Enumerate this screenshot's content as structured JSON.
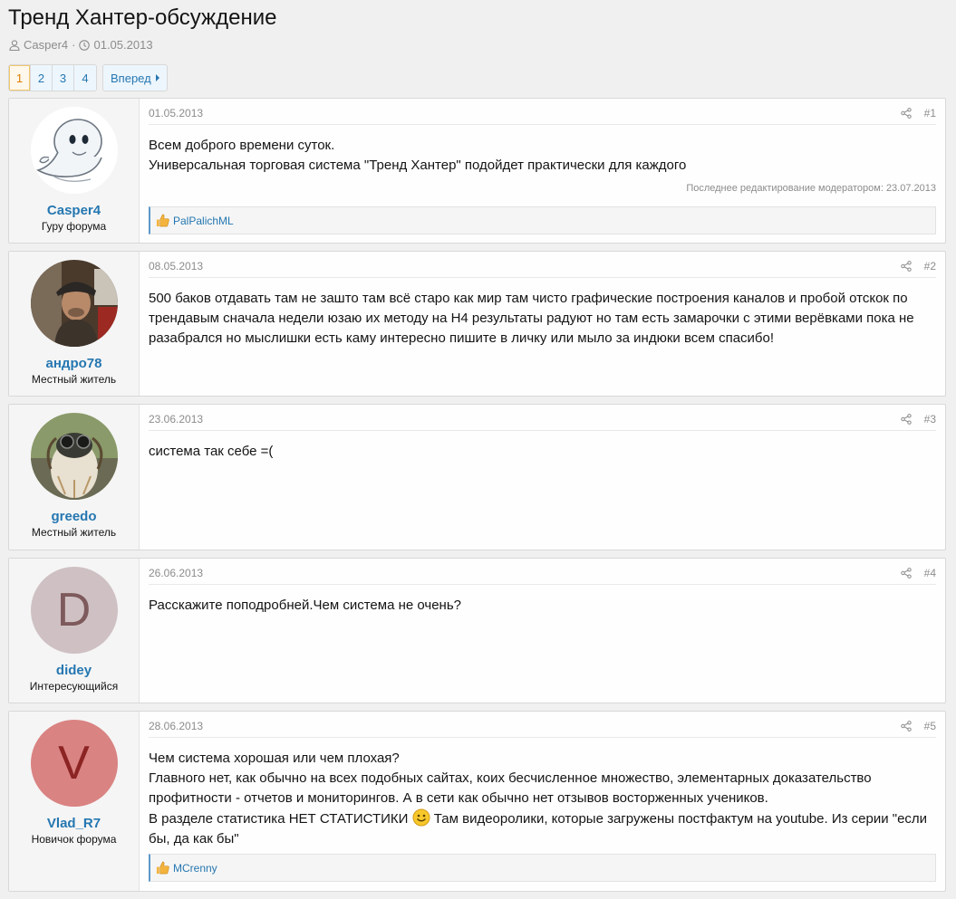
{
  "thread": {
    "title": "Тренд Хантер-обсуждение",
    "author": "Casper4",
    "separator": "·",
    "date": "01.05.2013"
  },
  "pagination": {
    "pages": [
      "1",
      "2",
      "3",
      "4"
    ],
    "current": "1",
    "next_label": "Вперед"
  },
  "colors": {
    "link": "#2577b1",
    "current_page": "#df7d00",
    "avatar_didey_bg": "#cfc1c3",
    "avatar_didey_fg": "#7e5a5c",
    "avatar_vlad_bg": "#d98382",
    "avatar_vlad_fg": "#8b2423"
  },
  "posts": [
    {
      "date": "01.05.2013",
      "number": "#1",
      "username": "Casper4",
      "user_title": "Гуру форума",
      "avatar": "casper-ghost-icon",
      "lines": [
        "Всем доброго времени суток.",
        "Универсальная торговая система \"Тренд Хантер\" подойдет практически для каждого"
      ],
      "edit_note": "Последнее редактирование модератором: 23.07.2013",
      "reaction_user": "PalPalichML"
    },
    {
      "date": "08.05.2013",
      "number": "#2",
      "username": "андро78",
      "user_title": "Местный житель",
      "avatar": "man-in-cap-photo",
      "lines": [
        "500 баков отдавать там не зашто там всё старо как мир там чисто графические построения каналов и пробой отскок по трендавым сначала недели юзаю их методу на Н4 результаты радуют но там есть замарочки с этими верёвками пока не разабрался но мыслишки есть каму интересно пишите в личку или мыло за индюки всем спасибо!"
      ]
    },
    {
      "date": "23.06.2013",
      "number": "#3",
      "username": "greedo",
      "user_title": "Местный житель",
      "avatar": "creature-with-goggles-photo",
      "lines": [
        "система так себе =("
      ]
    },
    {
      "date": "26.06.2013",
      "number": "#4",
      "username": "didey",
      "user_title": "Интересующийся",
      "avatar_letter": "D",
      "lines": [
        "Расскажите поподробней.Чем система не очень?"
      ]
    },
    {
      "date": "28.06.2013",
      "number": "#5",
      "username": "Vlad_R7",
      "user_title": "Новичок форума",
      "avatar_letter": "V",
      "lines": [
        "Чем система хорошая или чем плохая?",
        "Главного нет, как обычно на всех подобных сайтах, коих бесчисленное множество, элементарных доказательство профитности - отчетов и мониторингов. А в сети как обычно нет отзывов восторженных учеников."
      ],
      "line_before_smiley": "В разделе статистика НЕТ СТАТИСТИКИ",
      "line_after_smiley": "Там видеоролики, которые загружены постфактум на youtube. Из серии \"если бы, да как бы\"",
      "reaction_user": "MCrenny"
    }
  ]
}
